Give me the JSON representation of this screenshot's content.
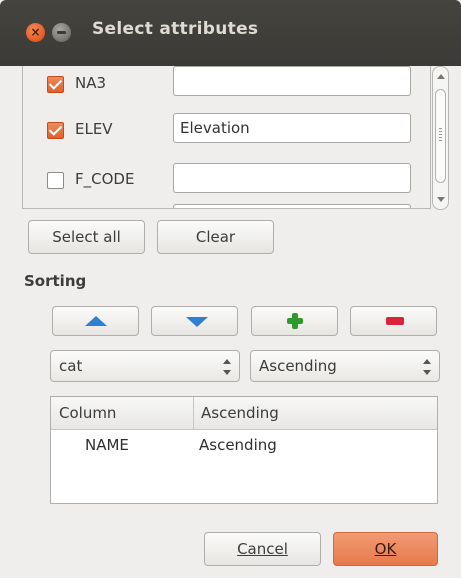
{
  "window": {
    "title": "Select attributes",
    "close_glyph": "×"
  },
  "attributes": [
    {
      "name": "NA3",
      "checked": true,
      "value": ""
    },
    {
      "name": "ELEV",
      "checked": true,
      "value": "Elevation"
    },
    {
      "name": "F_CODE",
      "checked": false,
      "value": ""
    }
  ],
  "selection_buttons": {
    "select_all": "Select all",
    "clear": "Clear"
  },
  "sorting": {
    "label": "Sorting",
    "tool_icons": [
      "arrow-up-icon",
      "arrow-down-icon",
      "plus-icon",
      "minus-icon"
    ],
    "column_combo": "cat",
    "order_combo": "Ascending",
    "table": {
      "headers": [
        "Column",
        "Ascending"
      ],
      "rows": [
        {
          "column": "NAME",
          "order": "Ascending"
        }
      ]
    }
  },
  "dialog_buttons": {
    "cancel": "Cancel",
    "ok": "OK"
  },
  "colors": {
    "accent": "#e7794a",
    "title_bar": "#3b3a36",
    "arrow_blue": "#2f7fd3",
    "add_green": "#2e9a2e",
    "remove_red": "#d8243a"
  }
}
